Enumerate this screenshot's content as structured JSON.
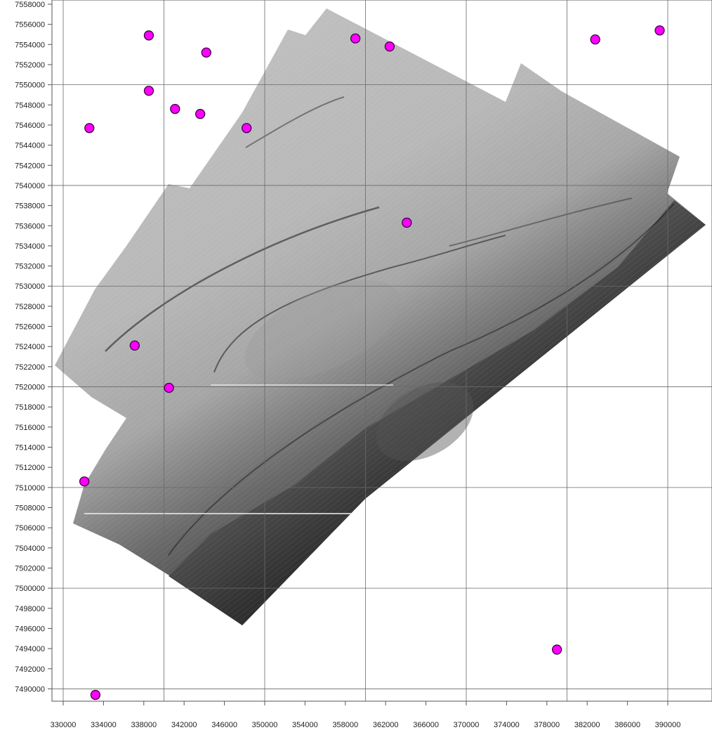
{
  "chart_data": {
    "type": "scatter",
    "background": "shaded-relief bathymetry survey mosaic (grayscale hillshade) with Easting/Northing grid",
    "xlim": [
      329000,
      392000
    ],
    "ylim": [
      7489000,
      7558000
    ],
    "grid": true,
    "x_tick_labels": [
      "330000",
      "334000",
      "338000",
      "342000",
      "346000",
      "350000",
      "354000",
      "358000",
      "362000",
      "366000",
      "370000",
      "374000",
      "378000",
      "382000",
      "386000",
      "390000"
    ],
    "y_tick_labels": [
      "7558000",
      "7556000",
      "7554000",
      "7552000",
      "7550000",
      "7548000",
      "7546000",
      "7544000",
      "7542000",
      "7540000",
      "7538000",
      "7536000",
      "7534000",
      "7532000",
      "7530000",
      "7528000",
      "7526000",
      "7524000",
      "7522000",
      "7520000",
      "7518000",
      "7516000",
      "7514000",
      "7512000",
      "7510000",
      "7508000",
      "7506000",
      "7504000",
      "7502000",
      "7500000",
      "7498000",
      "7496000",
      "7494000",
      "7492000",
      "7490000"
    ],
    "marker_color": "#ff00ff",
    "points": [
      {
        "x": 332600,
        "y": 7545700
      },
      {
        "x": 338500,
        "y": 7554900
      },
      {
        "x": 338500,
        "y": 7549400
      },
      {
        "x": 341100,
        "y": 7547600
      },
      {
        "x": 343600,
        "y": 7547100
      },
      {
        "x": 344200,
        "y": 7553200
      },
      {
        "x": 348200,
        "y": 7545700
      },
      {
        "x": 359000,
        "y": 7554600
      },
      {
        "x": 362400,
        "y": 7553800
      },
      {
        "x": 364100,
        "y": 7536300
      },
      {
        "x": 337100,
        "y": 7524100
      },
      {
        "x": 340500,
        "y": 7519900
      },
      {
        "x": 332100,
        "y": 7510600
      },
      {
        "x": 333200,
        "y": 7489400
      },
      {
        "x": 379000,
        "y": 7493900
      },
      {
        "x": 382800,
        "y": 7554500
      },
      {
        "x": 389200,
        "y": 7555400
      }
    ]
  }
}
